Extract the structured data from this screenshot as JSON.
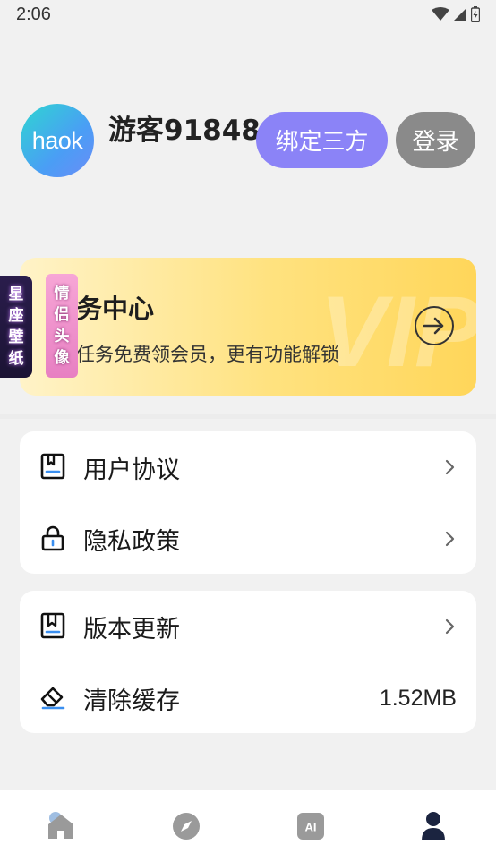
{
  "status_bar": {
    "time": "2:06"
  },
  "profile": {
    "avatar_text": "haok",
    "username": "游客918486",
    "bind_label": "绑定三方",
    "login_label": "登录"
  },
  "vip_card": {
    "title": "务中心",
    "subtitle": "任务免费领会员，更有功能解锁",
    "watermark": "VIP"
  },
  "floating_banners": {
    "left_text": [
      "星",
      "座",
      "壁",
      "纸"
    ],
    "right_text": [
      "情",
      "侣",
      "头",
      "像"
    ]
  },
  "menu_group_1": [
    {
      "label": "用户协议",
      "icon": "book-icon"
    },
    {
      "label": "隐私政策",
      "icon": "lock-icon"
    }
  ],
  "menu_group_2": [
    {
      "label": "版本更新",
      "icon": "bookmark-icon"
    },
    {
      "label": "清除缓存",
      "icon": "eraser-icon",
      "value": "1.52MB"
    }
  ],
  "tabbar": {
    "tabs": [
      {
        "icon": "home-icon",
        "active": false
      },
      {
        "icon": "compass-icon",
        "active": false
      },
      {
        "icon": "ai-icon",
        "label": "AI",
        "active": false
      },
      {
        "icon": "person-icon",
        "active": true
      }
    ]
  },
  "colors": {
    "bind_button": "#8b83f7",
    "login_button": "#8a8a8a",
    "vip_gradient_end": "#ffd65a",
    "active_tab": "#1b2440",
    "inactive_tab": "#9a9a9a"
  }
}
